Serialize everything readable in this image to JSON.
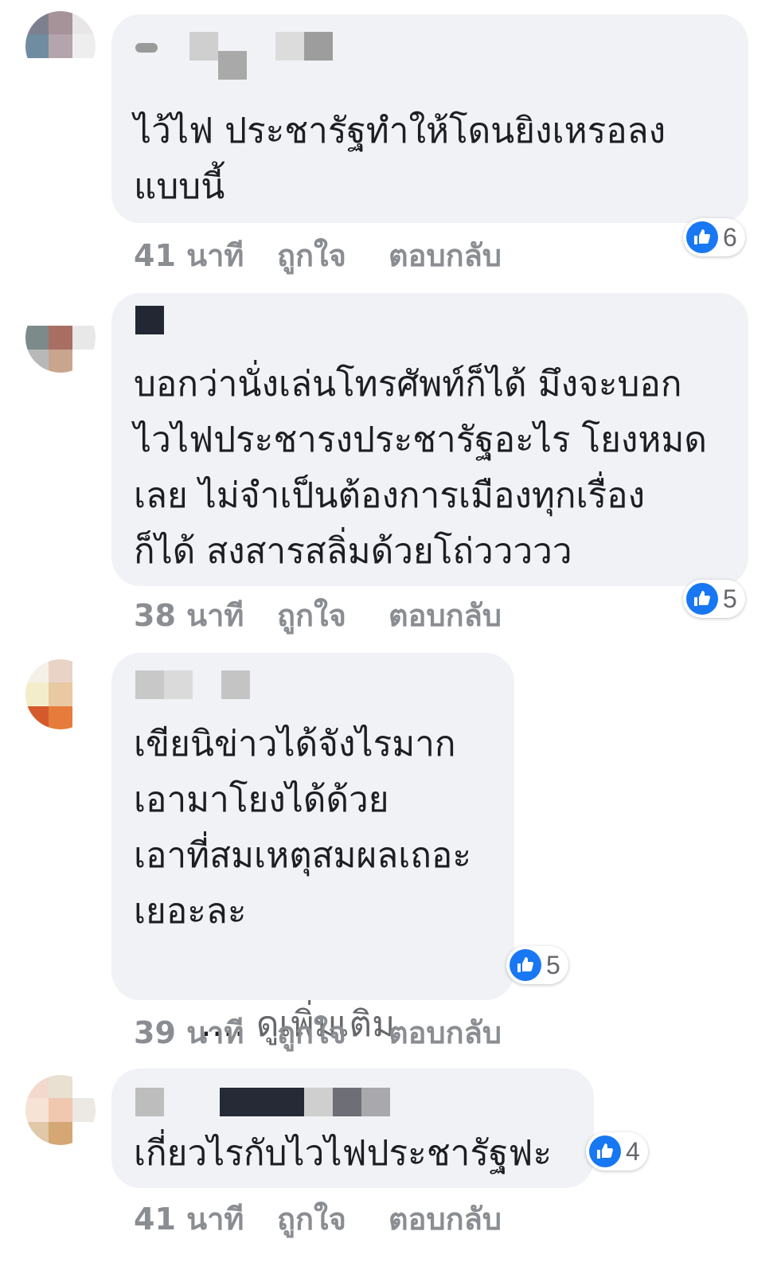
{
  "colors": {
    "bubble": "#f0f2f5",
    "meta_text": "#8a8d91",
    "like_blue": "#1877f2"
  },
  "comments": [
    {
      "text": "ไว้ไฟ ประชารัฐทำให้โดนยิงเหรอลง\nแบบนี้",
      "time": "41 นาที",
      "like_label": "ถูกใจ",
      "reply_label": "ตอบกลับ",
      "reaction_icon": "thumbs-up-icon",
      "reaction_count": "6"
    },
    {
      "text": "บอกว่านั่งเล่นโทรศัพท์ก็ได้ มึงจะบอก\nไวไฟประชารงประชารัฐอะไร โยงหมด\nเลย ไม่จำเป็นต้องการเมืองทุกเรื่อง\nก็ได้ สงสารสลิ่มด้วยโถ่ววววว",
      "time": "38 นาที",
      "like_label": "ถูกใจ",
      "reply_label": "ตอบกลับ",
      "reaction_icon": "thumbs-up-icon",
      "reaction_count": "5"
    },
    {
      "text": "เขียนิข่าวได้จังไรมาก\nเอามาโยงได้ด้วย\nเอาที่สมเหตุสมผลเถอะ\nเยอะละ",
      "see_more_dots": "....",
      "see_more_label": "ดูเพิ่มเติม",
      "time": "39 นาที",
      "like_label": "ถูกใจ",
      "reply_label": "ตอบกลับ",
      "reaction_icon": "thumbs-up-icon",
      "reaction_count": "5"
    },
    {
      "text": "เกี่ยวไรกับไวไฟประชารัฐฟะ",
      "time": "41 นาที",
      "like_label": "ถูกใจ",
      "reply_label": "ตอบกลับ",
      "reaction_icon": "thumbs-up-icon",
      "reaction_count": "4"
    }
  ]
}
